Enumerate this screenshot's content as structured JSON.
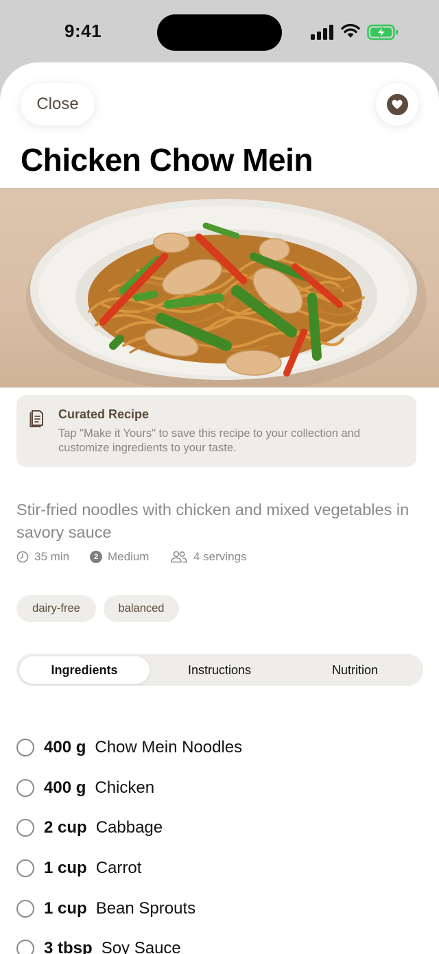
{
  "status": {
    "time": "9:41"
  },
  "header": {
    "close_label": "Close",
    "favorite_icon": "heart-icon"
  },
  "recipe": {
    "title": "Chicken Chow Mein",
    "description": "Stir-fried noodles with chicken and mixed vegetables in savory sauce",
    "time": "35 min",
    "difficulty_level": "2",
    "difficulty": "Medium",
    "servings": "4 servings",
    "tags": [
      "dairy-free",
      "balanced"
    ]
  },
  "curated": {
    "icon": "document-icon",
    "title": "Curated Recipe",
    "text": "Tap \"Make it Yours\" to save this recipe to your collection and customize ingredients to your taste."
  },
  "tabs": [
    {
      "label": "Ingredients",
      "active": true
    },
    {
      "label": "Instructions",
      "active": false
    },
    {
      "label": "Nutrition",
      "active": false
    }
  ],
  "ingredients": [
    {
      "qty": "400 g",
      "name": "Chow Mein Noodles"
    },
    {
      "qty": "400 g",
      "name": "Chicken"
    },
    {
      "qty": "2 cup",
      "name": "Cabbage"
    },
    {
      "qty": "1 cup",
      "name": "Carrot"
    },
    {
      "qty": "1 cup",
      "name": "Bean Sprouts"
    },
    {
      "qty": "3 tbsp",
      "name": "Soy Sauce"
    }
  ],
  "colors": {
    "accent": "#5c4a3c",
    "chip_bg": "#efedea",
    "muted_text": "#8a8a8a"
  }
}
